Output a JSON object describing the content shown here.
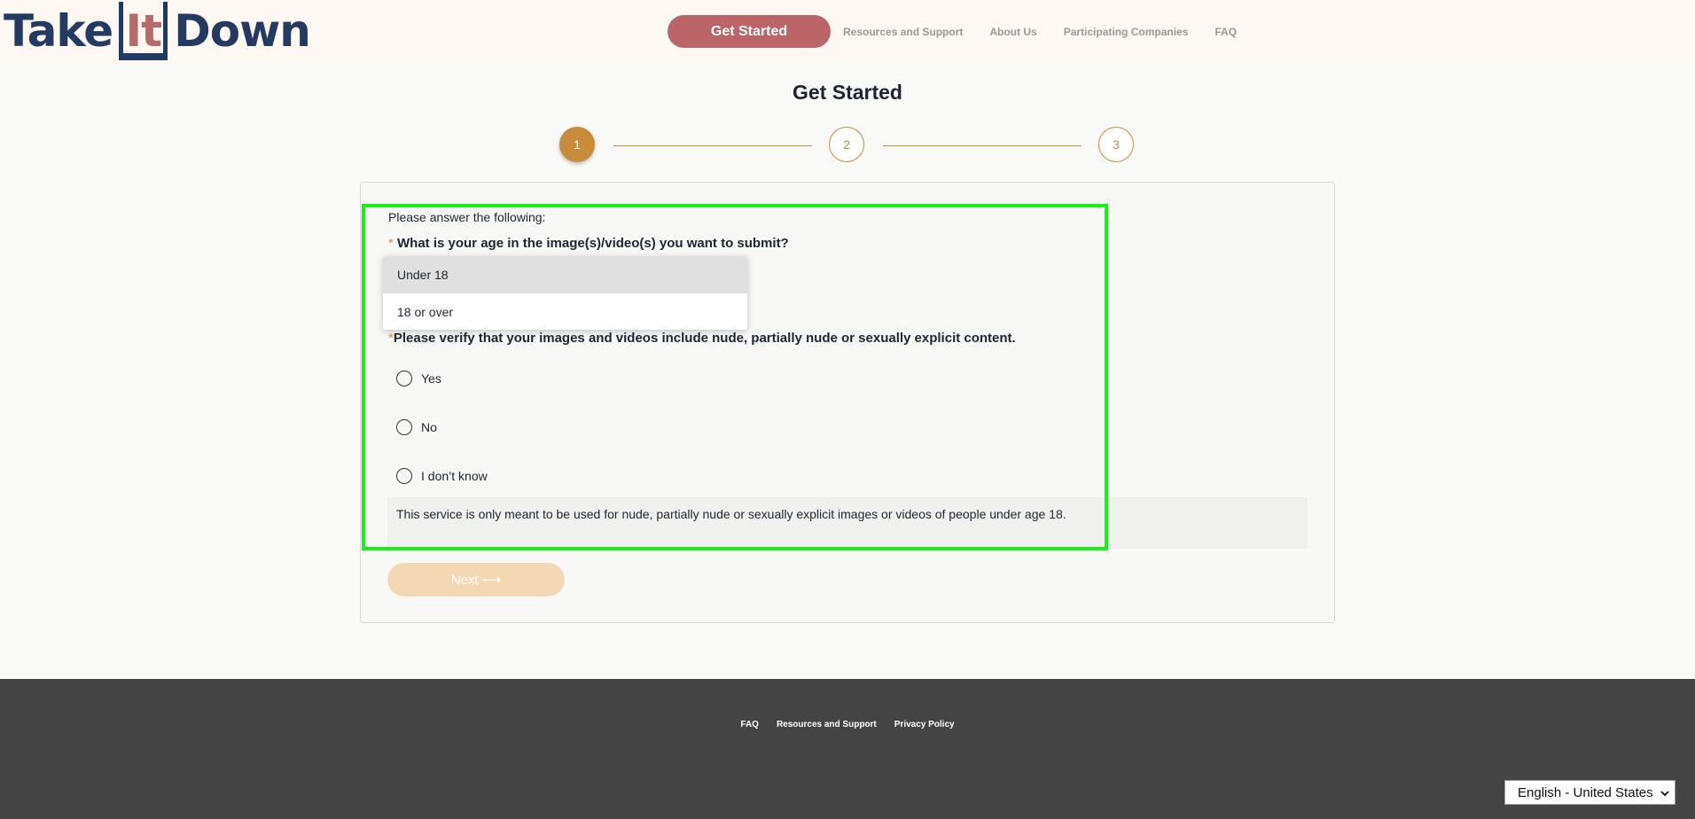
{
  "header": {
    "logo": {
      "part1": "Take",
      "part2": "It",
      "part3": "Down"
    },
    "nav": {
      "cta": "Get Started",
      "links": [
        "Resources and Support",
        "About Us",
        "Participating Companies",
        "FAQ"
      ]
    }
  },
  "page": {
    "title": "Get Started",
    "steps": [
      "1",
      "2",
      "3"
    ],
    "current_step": 1
  },
  "form": {
    "intro": "Please answer the following:",
    "q1": {
      "required_mark": "*",
      "label": "What is your age in the image(s)/video(s) you want to submit?"
    },
    "age_options": [
      "Under 18",
      "18 or over"
    ],
    "highlighted_option": "Under 18",
    "q2": {
      "required_mark": "*",
      "label": "Please verify that your images and videos include nude, partially nude or sexually explicit content."
    },
    "radio_options": [
      "Yes",
      "No",
      "I don’t know"
    ],
    "note": "This service is only meant to be used for nude, partially nude or sexually explicit images or videos of people under age 18.",
    "next_label": "Next ⟶"
  },
  "footer": {
    "links": [
      "FAQ",
      "Resources and Support",
      "Privacy Policy"
    ],
    "language": "English - United States"
  },
  "colors": {
    "brand_navy": "#243a60",
    "brand_rose": "#bb6569",
    "accent_gold": "#c88b3a",
    "highlight_green": "#18f018",
    "footer_bg": "#444444"
  }
}
